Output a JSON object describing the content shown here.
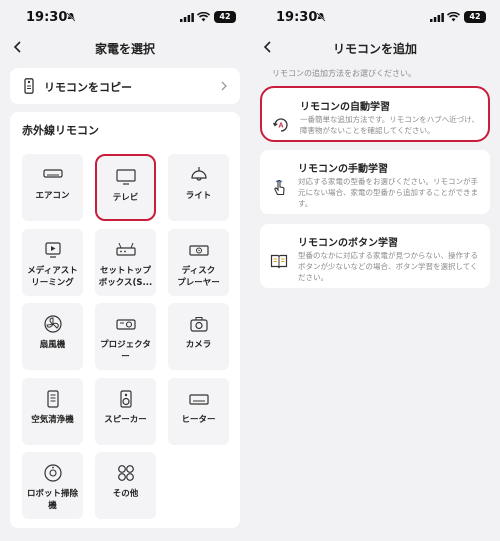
{
  "left": {
    "status": {
      "time": "19:30",
      "battery": "42"
    },
    "title": "家電を選択",
    "copy_label": "リモコンをコピー",
    "ir_title": "赤外線リモコン",
    "tiles": [
      {
        "label": "エアコン",
        "icon": "air-conditioner-icon"
      },
      {
        "label": "テレビ",
        "icon": "tv-icon"
      },
      {
        "label": "ライト",
        "icon": "light-icon"
      },
      {
        "label": "メディアスト\nリーミング",
        "icon": "media-streaming-icon"
      },
      {
        "label": "セットトップ\nボックス(S...",
        "icon": "set-top-box-icon"
      },
      {
        "label": "ディスク\nプレーヤー",
        "icon": "disc-player-icon"
      },
      {
        "label": "扇風機",
        "icon": "fan-icon"
      },
      {
        "label": "プロジェクタ\nー",
        "icon": "projector-icon"
      },
      {
        "label": "カメラ",
        "icon": "camera-icon"
      },
      {
        "label": "空気清浄機",
        "icon": "air-purifier-icon"
      },
      {
        "label": "スピーカー",
        "icon": "speaker-icon"
      },
      {
        "label": "ヒーター",
        "icon": "heater-icon"
      },
      {
        "label": "ロボット掃除\n機",
        "icon": "robot-vacuum-icon"
      },
      {
        "label": "その他",
        "icon": "other-icon"
      }
    ],
    "highlight_color": "#c81e3c"
  },
  "right": {
    "status": {
      "time": "19:30",
      "battery": "42"
    },
    "title": "リモコンを追加",
    "hint": "リモコンの追加方法をお選びください。",
    "options": [
      {
        "title": "リモコンの自動学習",
        "desc": "一番簡単な追加方法です。リモコンをハブへ近づけ、障害物がないことを確認してください。",
        "icon": "auto-learn-icon"
      },
      {
        "title": "リモコンの手動学習",
        "desc": "対応する家電の型番をお選びください。リモコンが手元にない場合、家電の型番から追加することができます。",
        "icon": "manual-learn-icon"
      },
      {
        "title": "リモコンのボタン学習",
        "desc": "型番のなかに対応する家電が見つからない、操作するボタンが少ないなどの場合、ボタン学習を選択してください。",
        "icon": "button-learn-icon"
      }
    ]
  }
}
